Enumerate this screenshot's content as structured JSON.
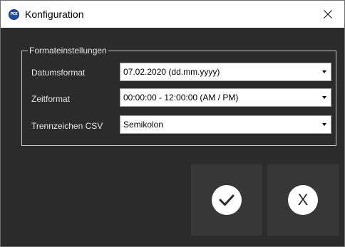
{
  "window": {
    "title": "Konfiguration",
    "app_icon_text": "PCE"
  },
  "group": {
    "legend": "Formateinstellungen"
  },
  "rows": [
    {
      "label": "Datumsformat",
      "value": "07.02.2020 (dd.mm.yyyy)"
    },
    {
      "label": "Zeitformat",
      "value": "00:00:00 - 12:00:00 (AM / PM)"
    },
    {
      "label": "Trennzeichen CSV",
      "value": "Semikolon"
    }
  ],
  "buttons": {
    "cancel_glyph": "X"
  },
  "colors": {
    "client_background": "#2b2b2b",
    "button_background": "#373737",
    "app_icon": "#1f4fa8"
  },
  "icons": {
    "app": "pce-logo-icon",
    "close": "close-icon",
    "dropdown": "dropdown-arrow-icon",
    "ok": "checkmark-icon"
  }
}
